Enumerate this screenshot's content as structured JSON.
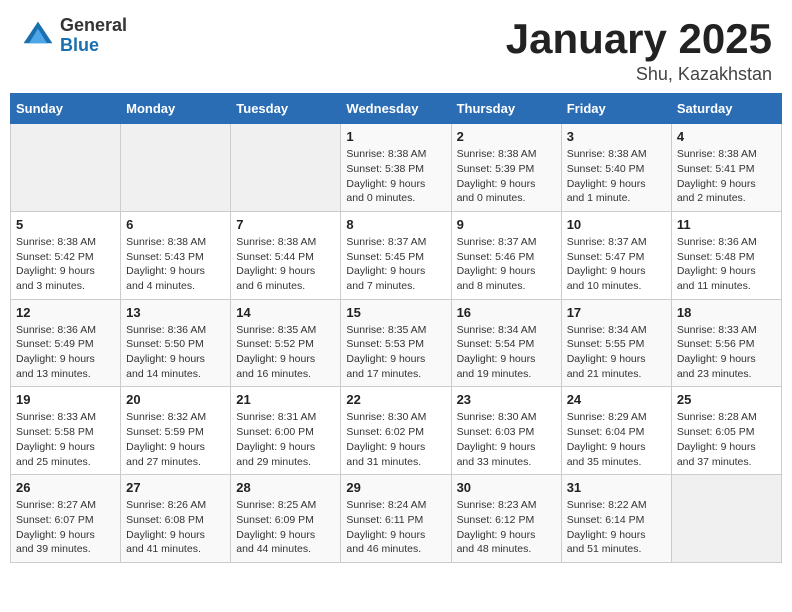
{
  "header": {
    "logo_general": "General",
    "logo_blue": "Blue",
    "month_title": "January 2025",
    "location": "Shu, Kazakhstan"
  },
  "days_of_week": [
    "Sunday",
    "Monday",
    "Tuesday",
    "Wednesday",
    "Thursday",
    "Friday",
    "Saturday"
  ],
  "weeks": [
    [
      {
        "day": "",
        "info": ""
      },
      {
        "day": "",
        "info": ""
      },
      {
        "day": "",
        "info": ""
      },
      {
        "day": "1",
        "info": "Sunrise: 8:38 AM\nSunset: 5:38 PM\nDaylight: 9 hours\nand 0 minutes."
      },
      {
        "day": "2",
        "info": "Sunrise: 8:38 AM\nSunset: 5:39 PM\nDaylight: 9 hours\nand 0 minutes."
      },
      {
        "day": "3",
        "info": "Sunrise: 8:38 AM\nSunset: 5:40 PM\nDaylight: 9 hours\nand 1 minute."
      },
      {
        "day": "4",
        "info": "Sunrise: 8:38 AM\nSunset: 5:41 PM\nDaylight: 9 hours\nand 2 minutes."
      }
    ],
    [
      {
        "day": "5",
        "info": "Sunrise: 8:38 AM\nSunset: 5:42 PM\nDaylight: 9 hours\nand 3 minutes."
      },
      {
        "day": "6",
        "info": "Sunrise: 8:38 AM\nSunset: 5:43 PM\nDaylight: 9 hours\nand 4 minutes."
      },
      {
        "day": "7",
        "info": "Sunrise: 8:38 AM\nSunset: 5:44 PM\nDaylight: 9 hours\nand 6 minutes."
      },
      {
        "day": "8",
        "info": "Sunrise: 8:37 AM\nSunset: 5:45 PM\nDaylight: 9 hours\nand 7 minutes."
      },
      {
        "day": "9",
        "info": "Sunrise: 8:37 AM\nSunset: 5:46 PM\nDaylight: 9 hours\nand 8 minutes."
      },
      {
        "day": "10",
        "info": "Sunrise: 8:37 AM\nSunset: 5:47 PM\nDaylight: 9 hours\nand 10 minutes."
      },
      {
        "day": "11",
        "info": "Sunrise: 8:36 AM\nSunset: 5:48 PM\nDaylight: 9 hours\nand 11 minutes."
      }
    ],
    [
      {
        "day": "12",
        "info": "Sunrise: 8:36 AM\nSunset: 5:49 PM\nDaylight: 9 hours\nand 13 minutes."
      },
      {
        "day": "13",
        "info": "Sunrise: 8:36 AM\nSunset: 5:50 PM\nDaylight: 9 hours\nand 14 minutes."
      },
      {
        "day": "14",
        "info": "Sunrise: 8:35 AM\nSunset: 5:52 PM\nDaylight: 9 hours\nand 16 minutes."
      },
      {
        "day": "15",
        "info": "Sunrise: 8:35 AM\nSunset: 5:53 PM\nDaylight: 9 hours\nand 17 minutes."
      },
      {
        "day": "16",
        "info": "Sunrise: 8:34 AM\nSunset: 5:54 PM\nDaylight: 9 hours\nand 19 minutes."
      },
      {
        "day": "17",
        "info": "Sunrise: 8:34 AM\nSunset: 5:55 PM\nDaylight: 9 hours\nand 21 minutes."
      },
      {
        "day": "18",
        "info": "Sunrise: 8:33 AM\nSunset: 5:56 PM\nDaylight: 9 hours\nand 23 minutes."
      }
    ],
    [
      {
        "day": "19",
        "info": "Sunrise: 8:33 AM\nSunset: 5:58 PM\nDaylight: 9 hours\nand 25 minutes."
      },
      {
        "day": "20",
        "info": "Sunrise: 8:32 AM\nSunset: 5:59 PM\nDaylight: 9 hours\nand 27 minutes."
      },
      {
        "day": "21",
        "info": "Sunrise: 8:31 AM\nSunset: 6:00 PM\nDaylight: 9 hours\nand 29 minutes."
      },
      {
        "day": "22",
        "info": "Sunrise: 8:30 AM\nSunset: 6:02 PM\nDaylight: 9 hours\nand 31 minutes."
      },
      {
        "day": "23",
        "info": "Sunrise: 8:30 AM\nSunset: 6:03 PM\nDaylight: 9 hours\nand 33 minutes."
      },
      {
        "day": "24",
        "info": "Sunrise: 8:29 AM\nSunset: 6:04 PM\nDaylight: 9 hours\nand 35 minutes."
      },
      {
        "day": "25",
        "info": "Sunrise: 8:28 AM\nSunset: 6:05 PM\nDaylight: 9 hours\nand 37 minutes."
      }
    ],
    [
      {
        "day": "26",
        "info": "Sunrise: 8:27 AM\nSunset: 6:07 PM\nDaylight: 9 hours\nand 39 minutes."
      },
      {
        "day": "27",
        "info": "Sunrise: 8:26 AM\nSunset: 6:08 PM\nDaylight: 9 hours\nand 41 minutes."
      },
      {
        "day": "28",
        "info": "Sunrise: 8:25 AM\nSunset: 6:09 PM\nDaylight: 9 hours\nand 44 minutes."
      },
      {
        "day": "29",
        "info": "Sunrise: 8:24 AM\nSunset: 6:11 PM\nDaylight: 9 hours\nand 46 minutes."
      },
      {
        "day": "30",
        "info": "Sunrise: 8:23 AM\nSunset: 6:12 PM\nDaylight: 9 hours\nand 48 minutes."
      },
      {
        "day": "31",
        "info": "Sunrise: 8:22 AM\nSunset: 6:14 PM\nDaylight: 9 hours\nand 51 minutes."
      },
      {
        "day": "",
        "info": ""
      }
    ]
  ]
}
